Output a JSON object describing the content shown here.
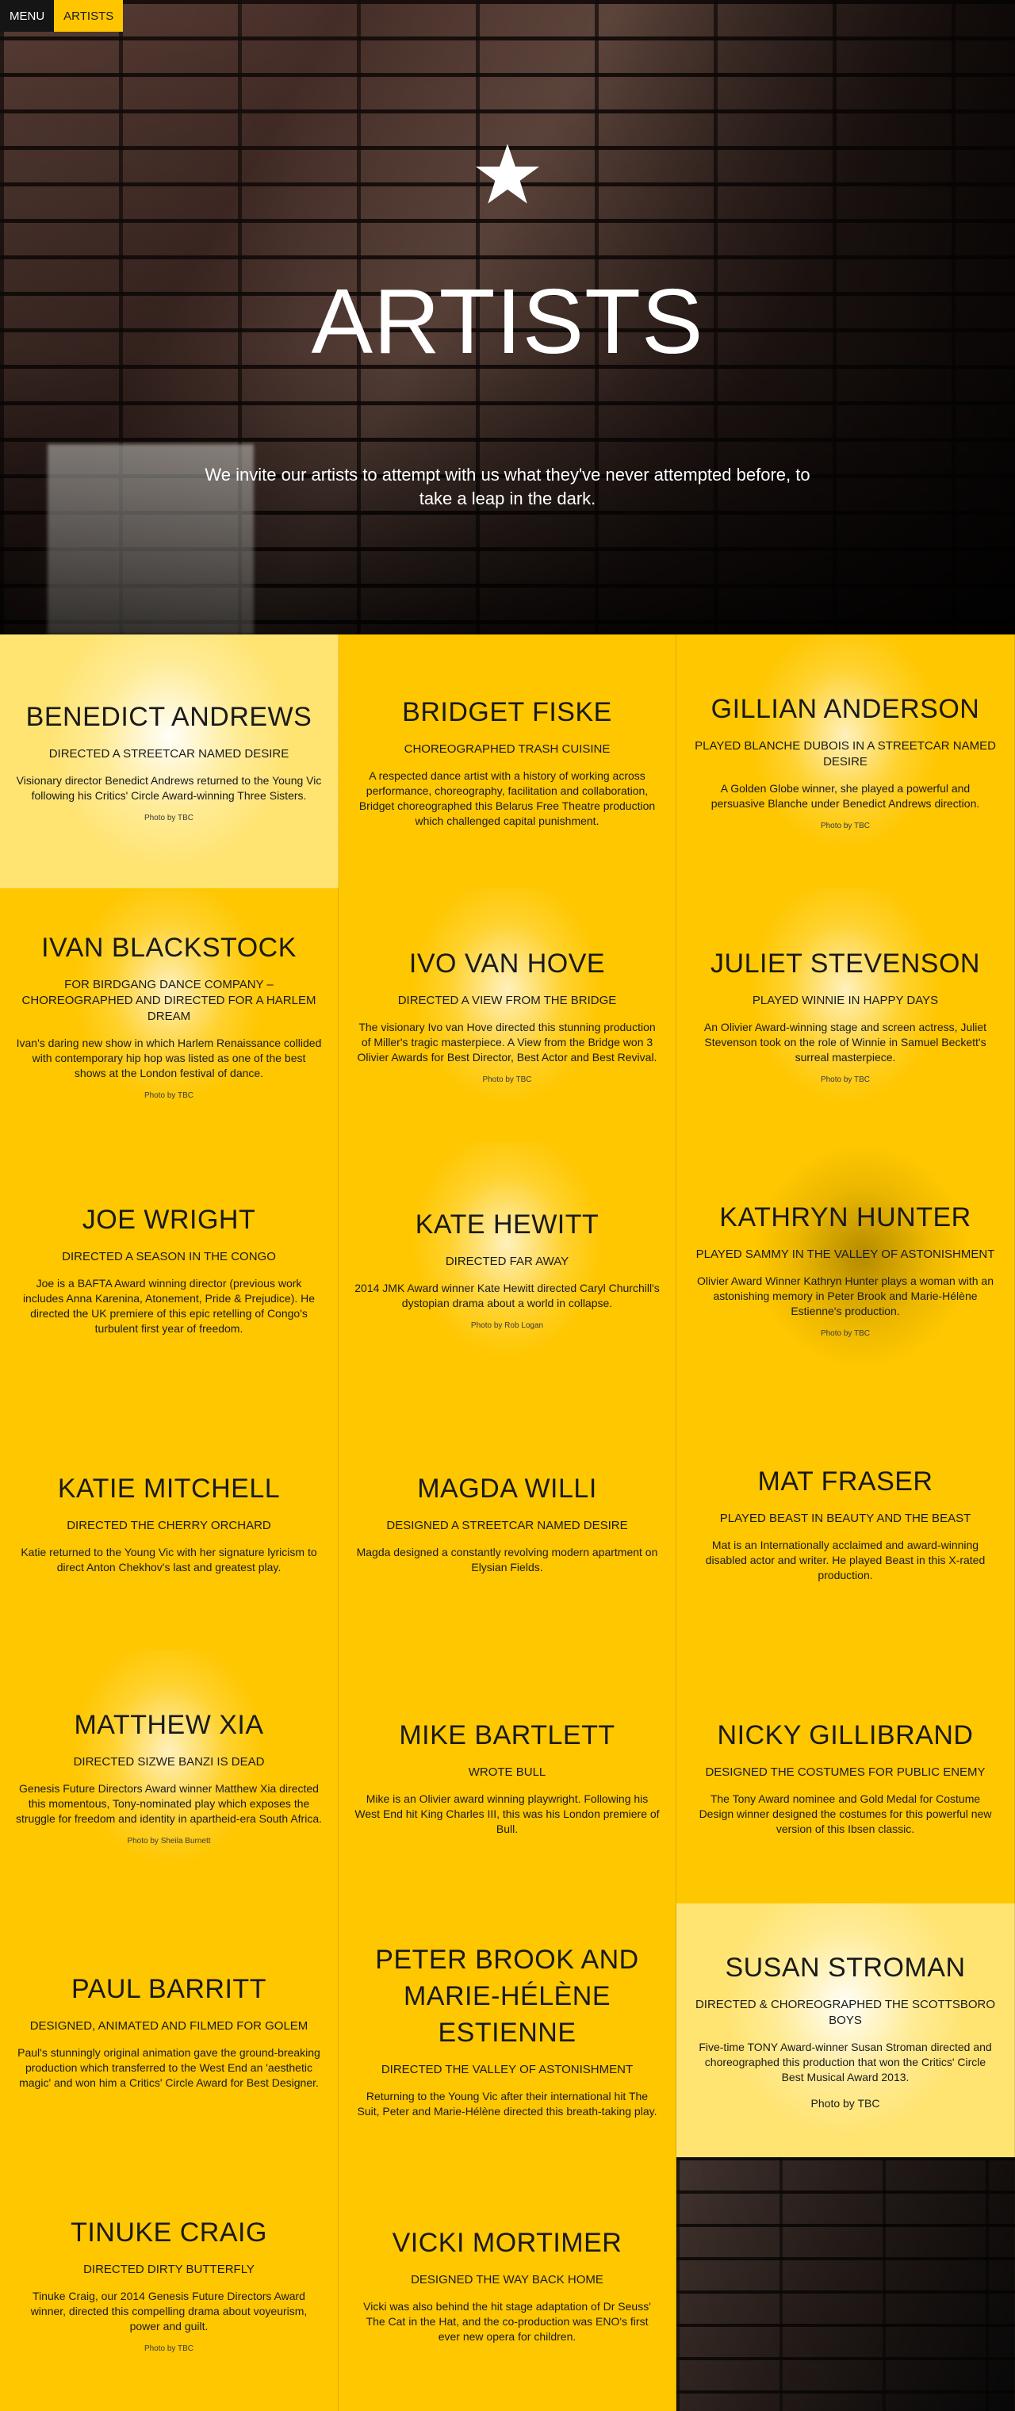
{
  "nav": {
    "menu_label": "MENU",
    "artists_label": "ARTISTS"
  },
  "hero": {
    "title": "ARTISTS",
    "tagline_line1": "We invite our artists to attempt with us what they've never attempted before, to",
    "tagline_line2": "take a leap in the dark.",
    "icon": "star-icon"
  },
  "colors": {
    "accent": "#ffc700",
    "text": "#1a1a1a",
    "menu_bg": "#151515"
  },
  "artists": [
    {
      "name": "BENEDICT ANDREWS",
      "role": "DIRECTED A STREETCAR NAMED DESIRE",
      "desc": "Visionary director Benedict Andrews returned to the Young Vic following his Critics' Circle Award-winning Three Sisters.",
      "credit": "Photo by TBC"
    },
    {
      "name": "BRIDGET FISKE",
      "role": "CHOREOGRAPHED TRASH CUISINE",
      "desc": "A respected dance artist with a history of working across performance, choreography, facilitation and collaboration, Bridget choreographed this Belarus Free Theatre production which challenged capital punishment.",
      "credit": ""
    },
    {
      "name": "GILLIAN ANDERSON",
      "role": "PLAYED BLANCHE DUBOIS IN A STREETCAR NAMED DESIRE",
      "desc": "A Golden Globe winner, she played a powerful and persuasive Blanche under Benedict Andrews direction.",
      "credit": "Photo by TBC"
    },
    {
      "name": "IVAN BLACKSTOCK",
      "role": "FOR BIRDGANG DANCE COMPANY – CHOREOGRAPHED AND DIRECTED FOR A HARLEM DREAM",
      "desc": "Ivan's daring new show in which Harlem Renaissance collided with contemporary hip hop was listed as one of the best shows at the London festival of dance.",
      "credit": "Photo by TBC"
    },
    {
      "name": "IVO VAN HOVE",
      "role": "DIRECTED A VIEW FROM THE BRIDGE",
      "desc": "The visionary Ivo van Hove directed this stunning production of Miller's tragic masterpiece. A View from the Bridge won 3 Olivier Awards for Best Director, Best Actor and Best Revival.",
      "credit": "Photo by TBC"
    },
    {
      "name": "JULIET STEVENSON",
      "role": "PLAYED WINNIE IN HAPPY DAYS",
      "desc": "An Olivier Award-winning stage and screen actress, Juliet Stevenson took on the role of Winnie in Samuel Beckett's surreal masterpiece.",
      "credit": "Photo by TBC"
    },
    {
      "name": "JOE WRIGHT",
      "role": "DIRECTED A SEASON IN THE CONGO",
      "desc": "Joe is a BAFTA Award winning director (previous work includes Anna Karenina, Atonement, Pride & Prejudice). He directed the UK premiere of this epic retelling of Congo's turbulent first year of freedom.",
      "credit": ""
    },
    {
      "name": "KATE HEWITT",
      "role": "DIRECTED FAR AWAY",
      "desc": "2014 JMK Award winner Kate Hewitt directed Caryl Churchill's dystopian drama about a world in collapse.",
      "credit": "Photo by Rob Logan"
    },
    {
      "name": "KATHRYN HUNTER",
      "role": "PLAYED SAMMY IN THE VALLEY OF ASTONISHMENT",
      "desc": "Olivier Award Winner Kathryn Hunter plays a woman with an astonishing memory in Peter Brook and Marie-Hélène Estienne's production.",
      "credit": "Photo by TBC"
    },
    {
      "name": "KATIE MITCHELL",
      "role": "DIRECTED THE CHERRY ORCHARD",
      "desc": "Katie returned to the Young Vic with her signature lyricism to direct Anton Chekhov's last and greatest play.",
      "credit": ""
    },
    {
      "name": "MAGDA WILLI",
      "role": "DESIGNED A STREETCAR NAMED DESIRE",
      "desc": "Magda designed a constantly revolving modern apartment on Elysian Fields.",
      "credit": ""
    },
    {
      "name": "MAT FRASER",
      "role": "PLAYED BEAST IN BEAUTY AND THE BEAST",
      "desc": "Mat is an Internationally acclaimed and award-winning disabled actor and writer. He played Beast in this X-rated production.",
      "credit": ""
    },
    {
      "name": "MATTHEW XIA",
      "role": "DIRECTED SIZWE BANZI IS DEAD",
      "desc": "Genesis Future Directors Award winner Matthew Xia directed this momentous, Tony-nominated play which exposes the struggle for freedom and identity in apartheid-era South Africa.",
      "credit": "Photo by Sheila Burnett"
    },
    {
      "name": "MIKE BARTLETT",
      "role": "WROTE BULL",
      "desc": "Mike is an Olivier award winning playwright. Following his West End hit King Charles III, this was his London premiere of Bull.",
      "credit": ""
    },
    {
      "name": "NICKY GILLIBRAND",
      "role": "DESIGNED THE COSTUMES FOR PUBLIC ENEMY",
      "desc": "The Tony Award nominee and Gold Medal for Costume Design winner designed the costumes for this powerful new version of this Ibsen classic.",
      "credit": ""
    },
    {
      "name": "PAUL BARRITT",
      "role": "DESIGNED, ANIMATED AND FILMED FOR GOLEM",
      "desc": "Paul's stunningly original animation gave the ground-breaking production which transferred to the West End an 'aesthetic magic' and won him a Critics' Circle Award for Best Designer.",
      "credit": ""
    },
    {
      "name": "PETER BROOK AND MARIE-HÉLÈNE ESTIENNE",
      "role": "DIRECTED THE VALLEY OF ASTONISHMENT",
      "desc": "Returning to the Young Vic after their international hit The Suit, Peter and Marie-Hélène directed this breath-taking play.",
      "credit": ""
    },
    {
      "name": "SUSAN STROMAN",
      "role": "DIRECTED & CHOREOGRAPHED THE SCOTTSBORO BOYS",
      "desc": "Five-time TONY Award-winner Susan Stroman directed and choreographed this production that won the Critics' Circle Best Musical Award 2013.",
      "credit": "Photo by TBC"
    },
    {
      "name": "TINUKE CRAIG",
      "role": "DIRECTED DIRTY BUTTERFLY",
      "desc": "Tinuke Craig, our 2014 Genesis Future Directors Award winner, directed this compelling drama about voyeurism, power and guilt.",
      "credit": "Photo by TBC"
    },
    {
      "name": "VICKI MORTIMER",
      "role": "DESIGNED THE WAY BACK HOME",
      "desc": "Vicki was also behind the hit stage adaptation of Dr Seuss' The Cat in the Hat, and the co-production was ENO's first ever new opera for children.",
      "credit": ""
    }
  ]
}
